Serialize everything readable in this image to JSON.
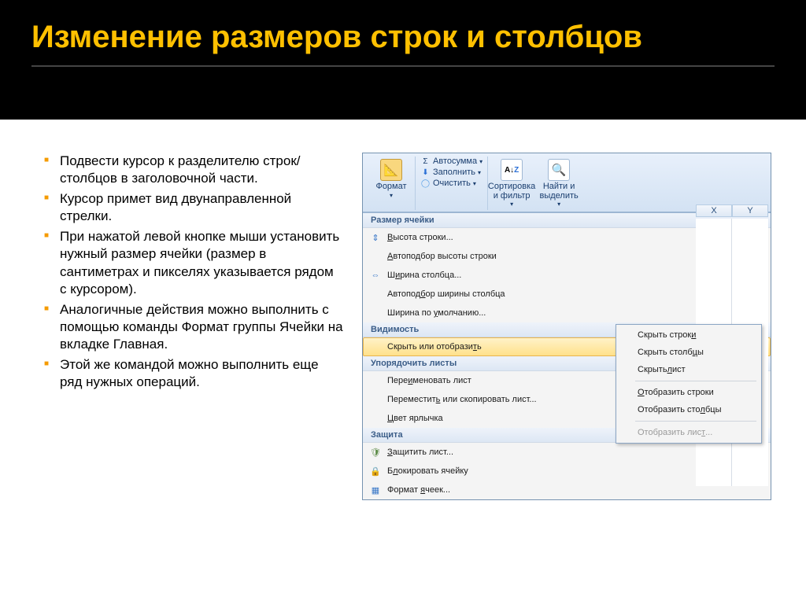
{
  "title": "Изменение размеров строк и столбцов",
  "bullets": [
    "Подвести курсор к разделителю строк/столбцов в заголовочной части.",
    "Курсор примет вид двунаправленной стрелки.",
    "При нажатой левой кнопке мыши установить нужный размер ячейки (размер в сантиметрах и пикселях указывается рядом с курсором).",
    "Аналогичные действия можно выполнить с помощью команды Формат группы Ячейки на вкладке Главная.",
    "Этой же командой можно выполнить еще ряд нужных операций."
  ],
  "ribbon": {
    "format": "Формат",
    "autosum": "Автосумма",
    "fill": "Заполнить",
    "clear": "Очистить",
    "sort": "Сортировка и фильтр",
    "find": "Найти и выделить"
  },
  "menu": {
    "section_size": "Размер ячейки",
    "row_height": "Высота строки...",
    "autofit_row": "Автоподбор высоты строки",
    "col_width": "Ширина столбца...",
    "autofit_col": "Автоподбор ширины столбца",
    "default_width": "Ширина по умолчанию...",
    "section_visibility": "Видимость",
    "hide_show": "Скрыть или отобразить",
    "section_organize": "Упорядочить листы",
    "rename": "Переименовать лист",
    "move_copy": "Переместить или скопировать лист...",
    "tab_color": "Цвет ярлычка",
    "section_protect": "Защита",
    "protect_sheet": "Защитить лист...",
    "lock_cell": "Блокировать ячейку",
    "format_cells": "Формат ячеек..."
  },
  "submenu": {
    "hide_rows": "Скрыть строки",
    "hide_cols": "Скрыть столбцы",
    "hide_sheet": "Скрыть лист",
    "show_rows": "Отобразить строки",
    "show_cols": "Отобразить столбцы",
    "show_sheet": "Отобразить лист..."
  },
  "cols": {
    "x": "X",
    "y": "Y"
  }
}
